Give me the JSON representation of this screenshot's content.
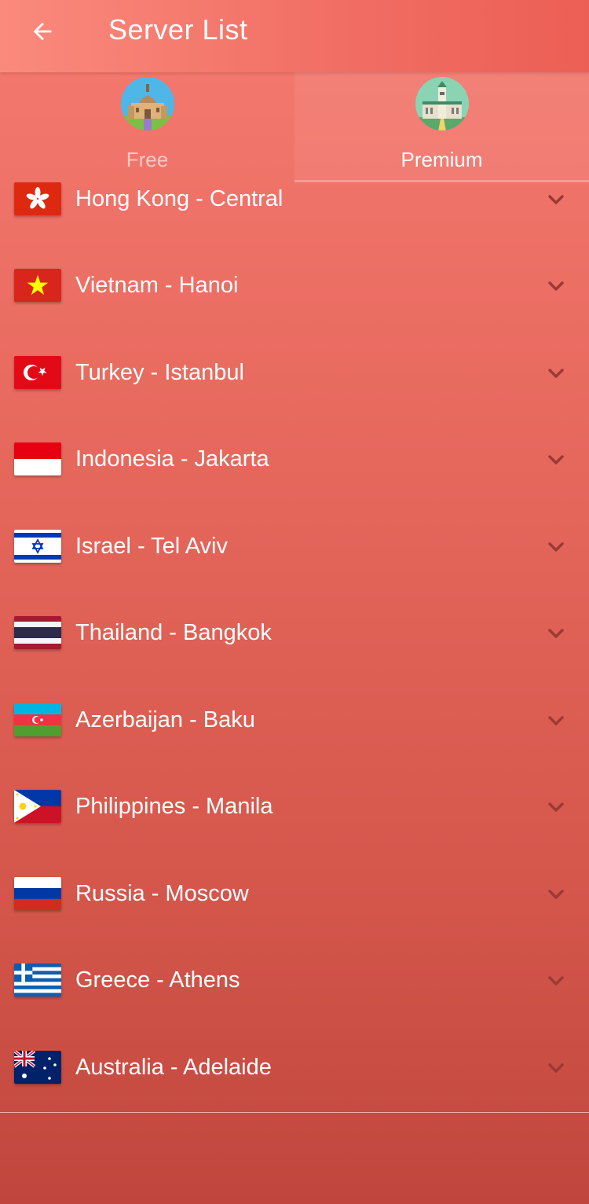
{
  "header": {
    "title": "Server List",
    "back_icon": "arrow-left-icon"
  },
  "tabs": [
    {
      "label": "Free",
      "icon": "cathedral-icon"
    },
    {
      "label": "Premium",
      "icon": "parliament-icon"
    }
  ],
  "selected_tab": "Premium",
  "servers": [
    {
      "label": "Hong Kong - Central",
      "flag": "hong-kong-flag-icon"
    },
    {
      "label": "Vietnam - Hanoi",
      "flag": "vietnam-flag-icon"
    },
    {
      "label": "Turkey - Istanbul",
      "flag": "turkey-flag-icon"
    },
    {
      "label": "Indonesia - Jakarta",
      "flag": "indonesia-flag-icon"
    },
    {
      "label": "Israel - Tel Aviv",
      "flag": "israel-flag-icon"
    },
    {
      "label": "Thailand - Bangkok",
      "flag": "thailand-flag-icon"
    },
    {
      "label": "Azerbaijan - Baku",
      "flag": "azerbaijan-flag-icon"
    },
    {
      "label": "Philippines - Manila",
      "flag": "philippines-flag-icon"
    },
    {
      "label": "Russia - Moscow",
      "flag": "russia-flag-icon"
    },
    {
      "label": "Greece - Athens",
      "flag": "greece-flag-icon"
    },
    {
      "label": "Australia - Adelaide",
      "flag": "australia-flag-icon"
    }
  ],
  "colors": {
    "background_top": "#f67a70",
    "background_bottom": "#c0463d",
    "chevron": "#9a3a33"
  }
}
